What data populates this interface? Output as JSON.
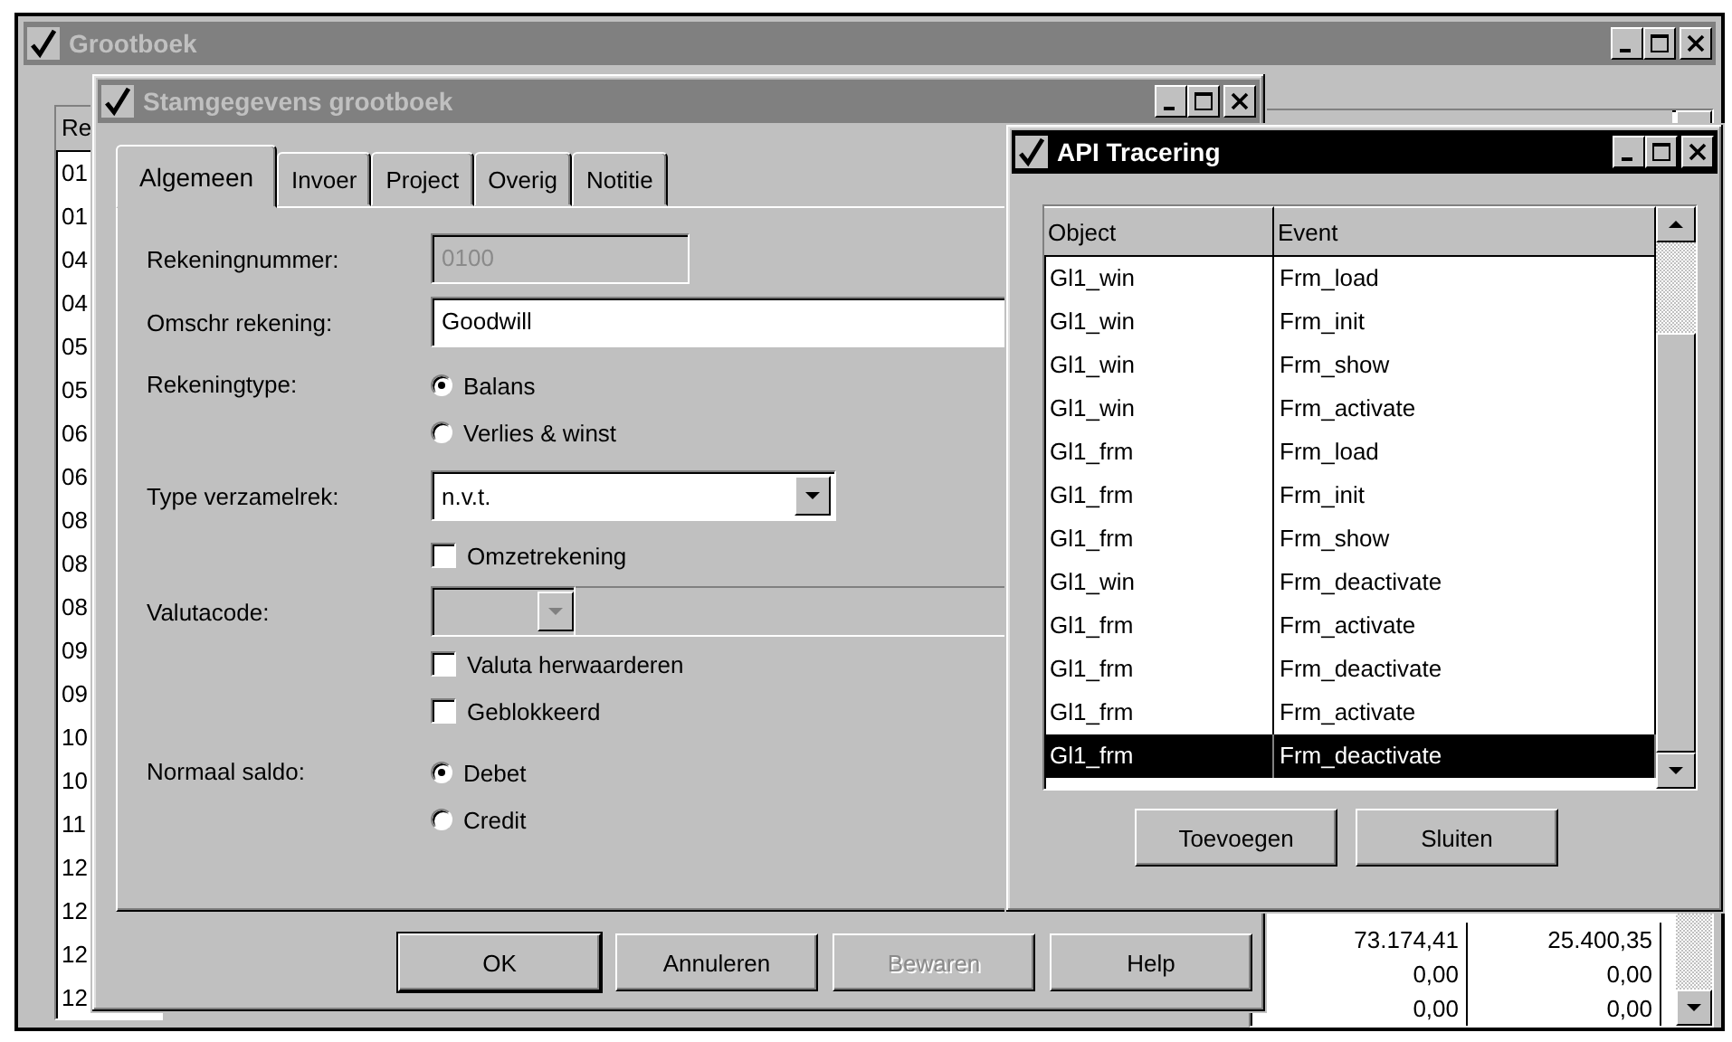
{
  "grootboek": {
    "title": "Grootboek",
    "active": false,
    "list": {
      "header": "Re",
      "rows": [
        "01",
        "01",
        "04",
        "04",
        "05",
        "05",
        "06",
        "06",
        "08",
        "08",
        "08",
        "09",
        "09",
        "10",
        "10",
        "11",
        "12",
        "12",
        "12",
        "12"
      ]
    },
    "table": {
      "rows": [
        {
          "column_1": "73.174,41",
          "column_2": "25.400,35"
        },
        {
          "column_1": "0,00",
          "column_2": "0,00"
        },
        {
          "column_1": "0,00",
          "column_2": "0,00"
        }
      ]
    }
  },
  "stamgegevens": {
    "title": "Stamgegevens grootboek",
    "active": false,
    "tabs": [
      {
        "label": "Algemeen",
        "selected": true
      },
      {
        "label": "Invoer",
        "selected": false
      },
      {
        "label": "Project",
        "selected": false
      },
      {
        "label": "Overig",
        "selected": false
      },
      {
        "label": "Notitie",
        "selected": false
      }
    ],
    "form": [
      {
        "kind": "text",
        "label": "Rekeningnummer:",
        "value": "0100",
        "disabled": true
      },
      {
        "kind": "text",
        "label": "Omschr rekening:",
        "value": "Goodwill",
        "disabled": false
      },
      {
        "kind": "radio",
        "label": "Rekeningtype:",
        "options": [
          {
            "label": "Balans",
            "selected": true
          },
          {
            "label": "Verlies & winst",
            "selected": false
          }
        ]
      },
      {
        "kind": "dropdown",
        "label": "Type verzamelrek:",
        "value": "n.v.t."
      },
      {
        "kind": "checkbox",
        "label": "Omzetrekening",
        "checked": false
      },
      {
        "kind": "combo",
        "label": "Valutacode:",
        "disabled": true
      },
      {
        "kind": "checkbox",
        "label": "Valuta herwaarderen",
        "checked": false
      },
      {
        "kind": "checkbox",
        "label": "Geblokkeerd",
        "checked": false
      },
      {
        "kind": "radio",
        "label": "Normaal saldo:",
        "options": [
          {
            "label": "Debet",
            "selected": true
          },
          {
            "label": "Credit",
            "selected": false
          }
        ]
      }
    ],
    "buttons": [
      {
        "label": "OK",
        "default": true,
        "disabled": false
      },
      {
        "label": "Annuleren",
        "default": false,
        "disabled": false
      },
      {
        "label": "Bewaren",
        "default": false,
        "disabled": true
      },
      {
        "label": "Help",
        "default": false,
        "disabled": false
      }
    ]
  },
  "api_tracering": {
    "title": "API Tracering",
    "active": true,
    "columns": [
      "Object",
      "Event"
    ],
    "rows": [
      {
        "object": "Gl1_win",
        "event": "Frm_load",
        "selected": false
      },
      {
        "object": "Gl1_win",
        "event": "Frm_init",
        "selected": false
      },
      {
        "object": "Gl1_win",
        "event": "Frm_show",
        "selected": false
      },
      {
        "object": "Gl1_win",
        "event": "Frm_activate",
        "selected": false
      },
      {
        "object": "Gl1_frm",
        "event": "Frm_load",
        "selected": false
      },
      {
        "object": "Gl1_frm",
        "event": "Frm_init",
        "selected": false
      },
      {
        "object": "Gl1_frm",
        "event": "Frm_show",
        "selected": false
      },
      {
        "object": "Gl1_win",
        "event": "Frm_deactivate",
        "selected": false
      },
      {
        "object": "Gl1_frm",
        "event": "Frm_activate",
        "selected": false
      },
      {
        "object": "Gl1_frm",
        "event": "Frm_deactivate",
        "selected": false
      },
      {
        "object": "Gl1_frm",
        "event": "Frm_activate",
        "selected": false
      },
      {
        "object": "Gl1_frm",
        "event": "Frm_deactivate",
        "selected": true
      }
    ],
    "buttons": [
      {
        "label": "Toevoegen"
      },
      {
        "label": "Sluiten"
      }
    ]
  }
}
